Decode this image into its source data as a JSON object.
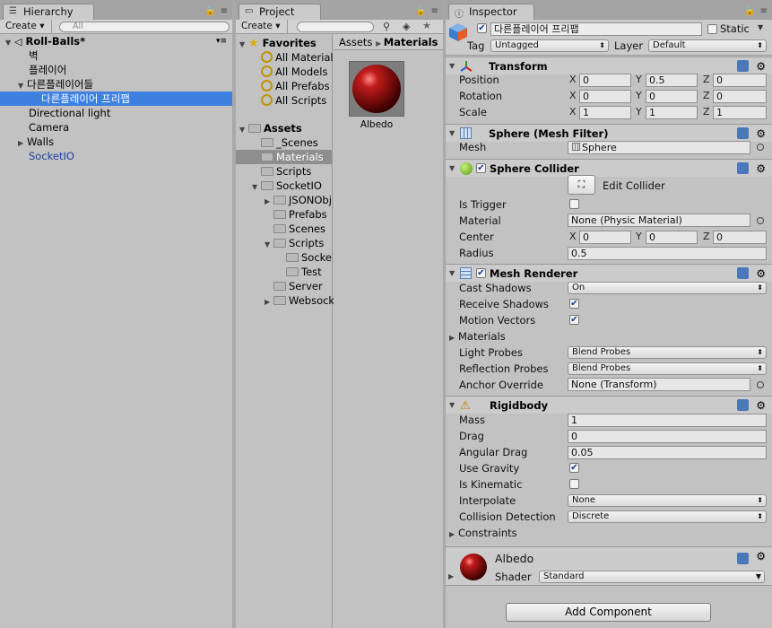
{
  "hierarchy": {
    "tab_label": "Hierarchy",
    "create_label": "Create",
    "search_placeholder": "All",
    "scene_name": "Roll-Balls*",
    "items": [
      {
        "label": "벽"
      },
      {
        "label": "플레이어"
      },
      {
        "label": "다른플레이어들"
      },
      {
        "label": "다른플레이어 프리팹"
      },
      {
        "label": "Directional light"
      },
      {
        "label": "Camera"
      },
      {
        "label": "Walls"
      },
      {
        "label": "SocketIO"
      }
    ]
  },
  "project": {
    "tab_label": "Project",
    "create_label": "Create",
    "favorites_label": "Favorites",
    "favorites": [
      "All Materials",
      "All Models",
      "All Prefabs",
      "All Scripts"
    ],
    "assets_label": "Assets",
    "tree": [
      "_Scenes",
      "Materials",
      "Scripts",
      "SocketIO",
      "JSONObj",
      "Prefabs",
      "Scenes",
      "Scripts",
      "Socke",
      "Test",
      "Server",
      "Websock"
    ],
    "breadcrumb": [
      "Assets",
      "Materials"
    ],
    "asset_item": "Albedo",
    "accent_color": "#3d80df"
  },
  "inspector": {
    "tab_label": "Inspector",
    "object_name": "다른플레이어 프리팹",
    "static_label": "Static",
    "tag_label": "Tag",
    "tag_value": "Untagged",
    "layer_label": "Layer",
    "layer_value": "Default",
    "transform": {
      "title": "Transform",
      "position_label": "Position",
      "rotation_label": "Rotation",
      "scale_label": "Scale",
      "position": [
        "0",
        "0.5",
        "0"
      ],
      "rotation": [
        "0",
        "0",
        "0"
      ],
      "scale": [
        "1",
        "1",
        "1"
      ]
    },
    "axis": [
      "X",
      "Y",
      "Z"
    ],
    "mesh_filter": {
      "title": "Sphere (Mesh Filter)",
      "mesh_label": "Mesh",
      "mesh_value": "Sphere"
    },
    "collider": {
      "title": "Sphere Collider",
      "edit_label": "Edit Collider",
      "is_trigger_label": "Is Trigger",
      "material_label": "Material",
      "material_value": "None (Physic Material)",
      "center_label": "Center",
      "center": [
        "0",
        "0",
        "0"
      ],
      "radius_label": "Radius",
      "radius_value": "0.5"
    },
    "renderer": {
      "title": "Mesh Renderer",
      "cast_shadows_label": "Cast Shadows",
      "cast_shadows_value": "On",
      "receive_shadows_label": "Receive Shadows",
      "motion_vectors_label": "Motion Vectors",
      "materials_label": "Materials",
      "light_probes_label": "Light Probes",
      "light_probes_value": "Blend Probes",
      "reflection_probes_label": "Reflection Probes",
      "reflection_probes_value": "Blend Probes",
      "anchor_override_label": "Anchor Override",
      "anchor_override_value": "None (Transform)"
    },
    "rigidbody": {
      "title": "Rigidbody",
      "mass_label": "Mass",
      "mass_value": "1",
      "drag_label": "Drag",
      "drag_value": "0",
      "angular_drag_label": "Angular Drag",
      "angular_drag_value": "0.05",
      "use_gravity_label": "Use Gravity",
      "is_kinematic_label": "Is Kinematic",
      "interpolate_label": "Interpolate",
      "interpolate_value": "None",
      "collision_detection_label": "Collision Detection",
      "collision_detection_value": "Discrete",
      "constraints_label": "Constraints"
    },
    "material": {
      "name": "Albedo",
      "shader_label": "Shader",
      "shader_value": "Standard"
    },
    "add_component_label": "Add Component"
  }
}
